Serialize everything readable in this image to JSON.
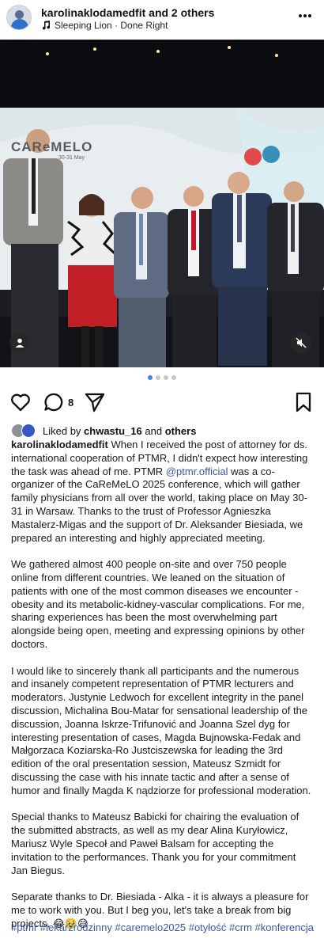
{
  "header": {
    "username": "karolinaklodamedfit",
    "and_others": "and 2 others",
    "audio": "Sleeping Lion · Done Right"
  },
  "media": {
    "banner_text": "CAReMELO",
    "banner_sub": "30-31 May"
  },
  "carousel": {
    "count": 4,
    "active_index": 0
  },
  "actions": {
    "comment_count": "8"
  },
  "likes": {
    "prefix": "Liked by",
    "user": "chwastu_16",
    "and": "and",
    "others": "others"
  },
  "caption": {
    "user": "karolinaklodamedfit",
    "p1a": "When I received the post of attorney for ds. international cooperation of PTMR, I didn't expect how interesting the task was ahead of me. PTMR",
    "mention": "@ptmr.official",
    "p1b": "was a co-organizer of the CaReMeLO 2025 conference, which will gather family physicians from all over the world, taking place on May 30-31 in Warsaw. Thanks to the trust of Professor Agnieszka Mastalerz-Migas and the support of Dr. Aleksander Biesiada, we prepared an interesting and highly appreciated meeting.",
    "p2": "We gathered almost 400 people on-site and over 750 people online from different countries. We leaned on the situation of patients with one of the most common diseases we encounter - obesity and its metabolic-kidney-vascular complications. For me, sharing experiences has been the most overwhelming part alongside being open, meeting and expressing opinions by other doctors.",
    "p3": "I would like to sincerely thank all participants and the numerous and insanely competent representation of PTMR lecturers and moderators. Justynie Ledwoch for excellent integrity in the panel discussion, Michalina Bou-Matar for sensational leadership of the discussion, Joanna Iskrze-Trifunović and Joanna Szel dyg for interesting presentation of cases, Magda Bujnowska-Fedak and Małgorzaca Koziarska-Ro Justciszewska for leading the 3rd edition of the oral presentation session, Mateusz Szmidt for discussing the case with his innate tactic and after a sense of humor and finally Magda K nądziorze for professional moderation.",
    "p4": "Special thanks to Mateusz Babicki for chairing the evaluation of the submitted abstracts, as well as my dear Alina Kuryłowicz, Mariusz Wyle Specoł and Paweł Balsam for accepting the invitation to the performances. Thank you for your commitment Jan Biegus.",
    "p5": "Separate thanks to Dr. Biesiada - Alka - it is always a pleasure for me to work with you. But I beg you, let's take a break from big projects. 😂🥹😅"
  },
  "hashtags": " #ptmr #lekarzrodzinny #caremelo2025 #otyłość #crm #konferencja",
  "colors": {
    "link": "#3b59a8",
    "active_dot": "#3b82f6"
  },
  "icons": [
    "more-icon",
    "music-note-icon",
    "heart-icon",
    "comment-icon",
    "share-icon",
    "bookmark-icon",
    "user-tag-icon",
    "mute-icon"
  ]
}
